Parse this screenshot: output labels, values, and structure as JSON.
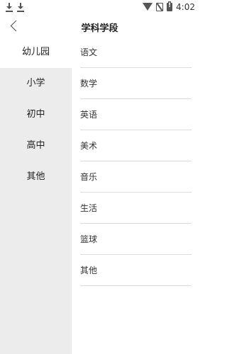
{
  "status_bar": {
    "time": "4:02",
    "left_icons": [
      "download-icon",
      "download-icon"
    ],
    "right_icons": [
      "wifi-icon",
      "no-sim-icon",
      "battery-icon"
    ]
  },
  "header": {
    "title": "学科学段",
    "back_icon": "chevron-left-icon"
  },
  "sidebar": {
    "selected": "幼儿园",
    "items": [
      {
        "label": "幼儿园"
      },
      {
        "label": "小学"
      },
      {
        "label": "初中"
      },
      {
        "label": "高中"
      },
      {
        "label": "其他"
      }
    ]
  },
  "subjects": {
    "items": [
      {
        "label": "语文"
      },
      {
        "label": "数学"
      },
      {
        "label": "英语"
      },
      {
        "label": "美术"
      },
      {
        "label": "音乐"
      },
      {
        "label": "生活"
      },
      {
        "label": "篮球"
      },
      {
        "label": "其他"
      }
    ]
  },
  "colors": {
    "sidebar_bg": "#ececec",
    "selected_bg": "#ffffff",
    "divider": "#dcdcdc"
  }
}
